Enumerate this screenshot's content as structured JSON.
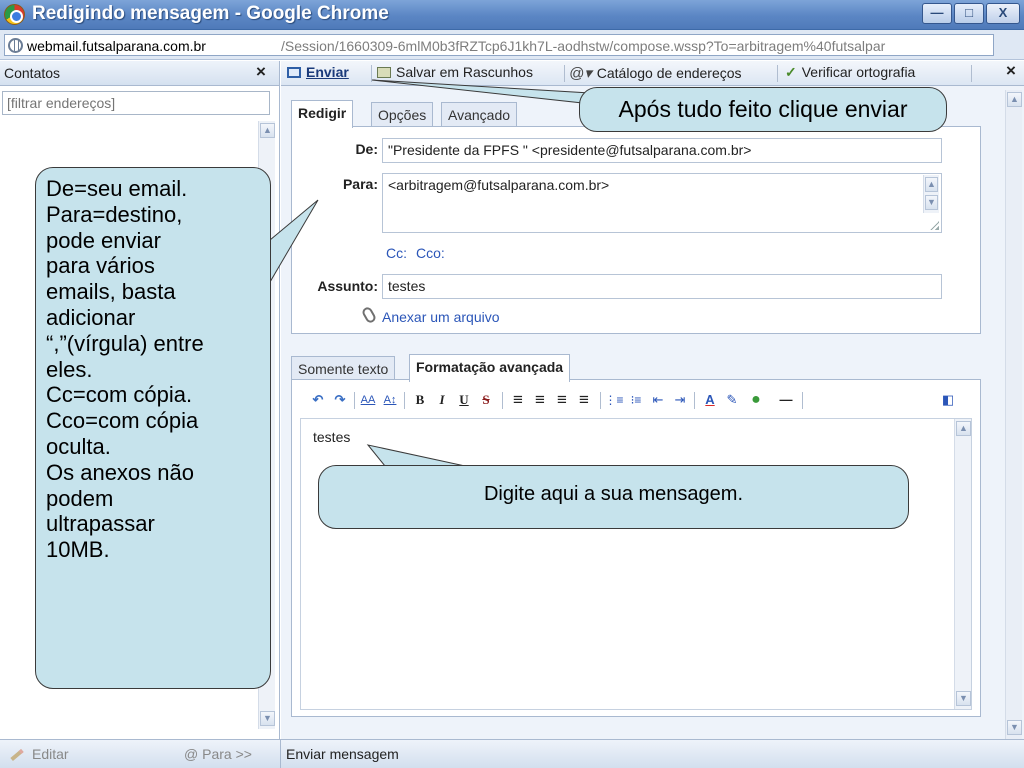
{
  "window": {
    "title": "Redigindo mensagem - Google Chrome",
    "min_label": "—",
    "max_label": "□",
    "close_label": "X"
  },
  "address": {
    "host": "webmail.futsalparana.com.br",
    "path": "/Session/1660309-6mlM0b3fRZTcp6J1kh7L-aodhstw/compose.wssp?To=arbitragem%40futsalpar"
  },
  "sidebar": {
    "title": "Contatos",
    "close_label": "×",
    "filter_placeholder": "[filtrar endereços]"
  },
  "footer": {
    "edit_label": "Editar",
    "para_label": "@  Para >>",
    "status": "Enviar mensagem"
  },
  "toolbar": {
    "send_label": "Enviar",
    "drafts_label": "Salvar em Rascunhos",
    "address_book_label": "Catálogo de endereços",
    "spellcheck_label": "Verificar ortografia",
    "close_label": "×"
  },
  "compose": {
    "tabs": [
      {
        "label": "Redigir"
      },
      {
        "label": "Opções"
      },
      {
        "label": "Avançado"
      }
    ],
    "from_label": "De:",
    "from_value": "\"Presidente da FPFS \" <presidente@futsalparana.com.br>",
    "to_label": "Para:",
    "to_value": "<arbitragem@futsalparana.com.br>",
    "cc_label": "Cc:",
    "bcc_label": "Cco:",
    "subject_label": "Assunto:",
    "subject_value": "testes",
    "attach_label": "Anexar um arquivo"
  },
  "editor": {
    "tabs": [
      {
        "label": "Somente texto"
      },
      {
        "label": "Formatação avançada"
      }
    ],
    "body": "testes",
    "fmt_buttons": {
      "undo": "↶",
      "redo": "↷",
      "font_size": "AA",
      "font_grow": "A↕",
      "bold": "B",
      "italic": "I",
      "underline": "U",
      "strike": "S",
      "align_left": "≡",
      "align_center": "≡",
      "align_right": "≡",
      "justify": "≡",
      "ordered_list": "⋮≡",
      "bullet_list": "⁝≡",
      "outdent": "⇤",
      "indent": "⇥",
      "text_color": "A",
      "highlight": "✎",
      "link": "●",
      "hr": "—",
      "source": "◧"
    }
  },
  "callouts": {
    "sidebar_lines": [
      "De=seu email.",
      "Para=destino,",
      "pode enviar",
      "para vários",
      "emails, basta",
      "adicionar",
      "“,”(vírgula) entre",
      "eles.",
      "Cc=com cópia.",
      "Cco=com cópia",
      "oculta.",
      "Os anexos não",
      "podem",
      "ultrapassar",
      "10MB."
    ],
    "send": "Após tudo feito clique enviar",
    "editor": "Digite aqui a sua mensagem."
  },
  "colors": {
    "callout_bg": "#c6e3ec",
    "titlebar": "#5b86c4",
    "link": "#2b56b8"
  }
}
